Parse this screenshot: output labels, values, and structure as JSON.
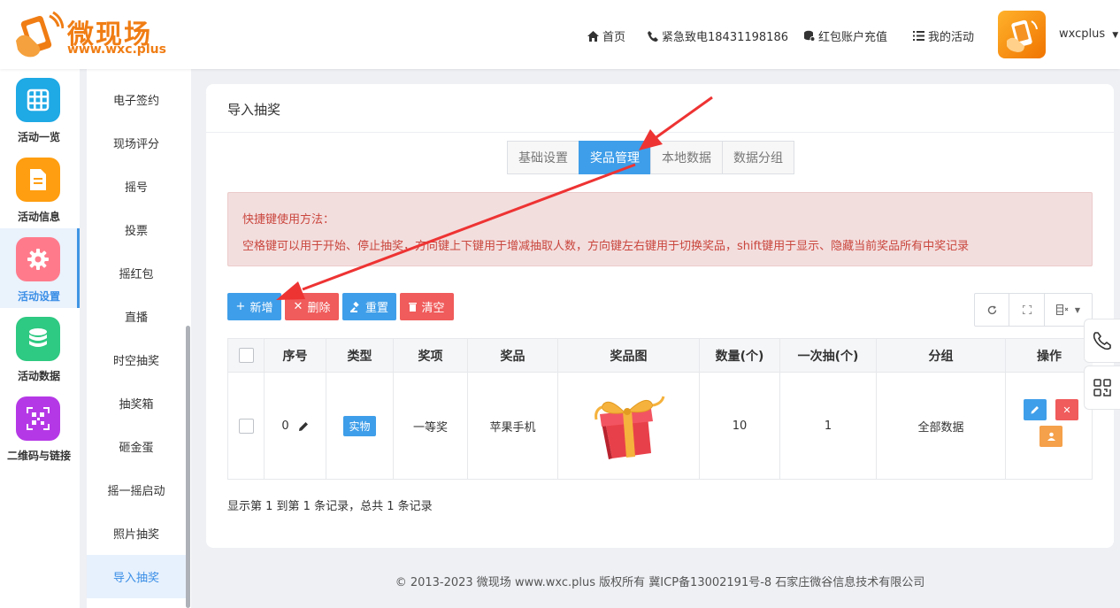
{
  "brand": {
    "name": "微现场",
    "url": "www.wxc.plus"
  },
  "topnav": [
    {
      "icon": "home-icon",
      "label": "首页"
    },
    {
      "icon": "phone-icon",
      "label": "紧急致电18431198186"
    },
    {
      "icon": "coins-icon",
      "label": "红包账户充值"
    },
    {
      "icon": "list-icon",
      "label": "我的活动"
    }
  ],
  "user": {
    "name": "wxcplus"
  },
  "sidebar_main": [
    {
      "label": "活动一览",
      "icon": "grid-icon",
      "color": "#1fa9e5",
      "active": false
    },
    {
      "label": "活动信息",
      "icon": "document-icon",
      "color": "#ff9e10",
      "active": false
    },
    {
      "label": "活动设置",
      "icon": "gear-icon",
      "color": "#ff7b8c",
      "active": true
    },
    {
      "label": "活动数据",
      "icon": "database-icon",
      "color": "#2ec982",
      "active": false
    },
    {
      "label": "二维码与链接",
      "icon": "qrcode-icon",
      "color": "#b538e6",
      "active": false
    }
  ],
  "sidebar_sub": [
    "电子签约",
    "现场评分",
    "摇号",
    "投票",
    "摇红包",
    "直播",
    "时空抽奖",
    "抽奖箱",
    "砸金蛋",
    "摇一摇启动",
    "照片抽奖",
    "导入抽奖"
  ],
  "sidebar_sub_active": "导入抽奖",
  "page": {
    "title": "导入抽奖"
  },
  "tabs": [
    {
      "label": "基础设置",
      "active": false
    },
    {
      "label": "奖品管理",
      "active": true
    },
    {
      "label": "本地数据",
      "active": false
    },
    {
      "label": "数据分组",
      "active": false
    }
  ],
  "alert": {
    "title": "快捷键使用方法：",
    "text": "空格键可以用于开始、停止抽奖，方向键上下键用于增减抽取人数，方向键左右键用于切换奖品，shift键用于显示、隐藏当前奖品所有中奖记录"
  },
  "toolbar": {
    "add": "新增",
    "delete": "删除",
    "reset": "重置",
    "clear": "清空",
    "add_color": "#3f9ee9",
    "delete_color": "#f05b5b",
    "reset_color": "#3f9ee9",
    "clear_color": "#f05b5b"
  },
  "table": {
    "headers": [
      "序号",
      "类型",
      "奖项",
      "奖品",
      "奖品图",
      "数量(个)",
      "一次抽(个)",
      "分组",
      "操作"
    ],
    "rows": [
      {
        "index": "0",
        "type": "实物",
        "level": "一等奖",
        "prize": "苹果手机",
        "image": "gift-box-image",
        "quantity": "10",
        "per_draw": "1",
        "group": "全部数据"
      }
    ]
  },
  "pagination": "显示第 1 到第 1 条记录，总共 1 条记录",
  "footer": "© 2013-2023 微现场 www.wxc.plus 版权所有 冀ICP备13002191号-8 石家庄微谷信息技术有限公司",
  "annotation_color": "#ee3333"
}
